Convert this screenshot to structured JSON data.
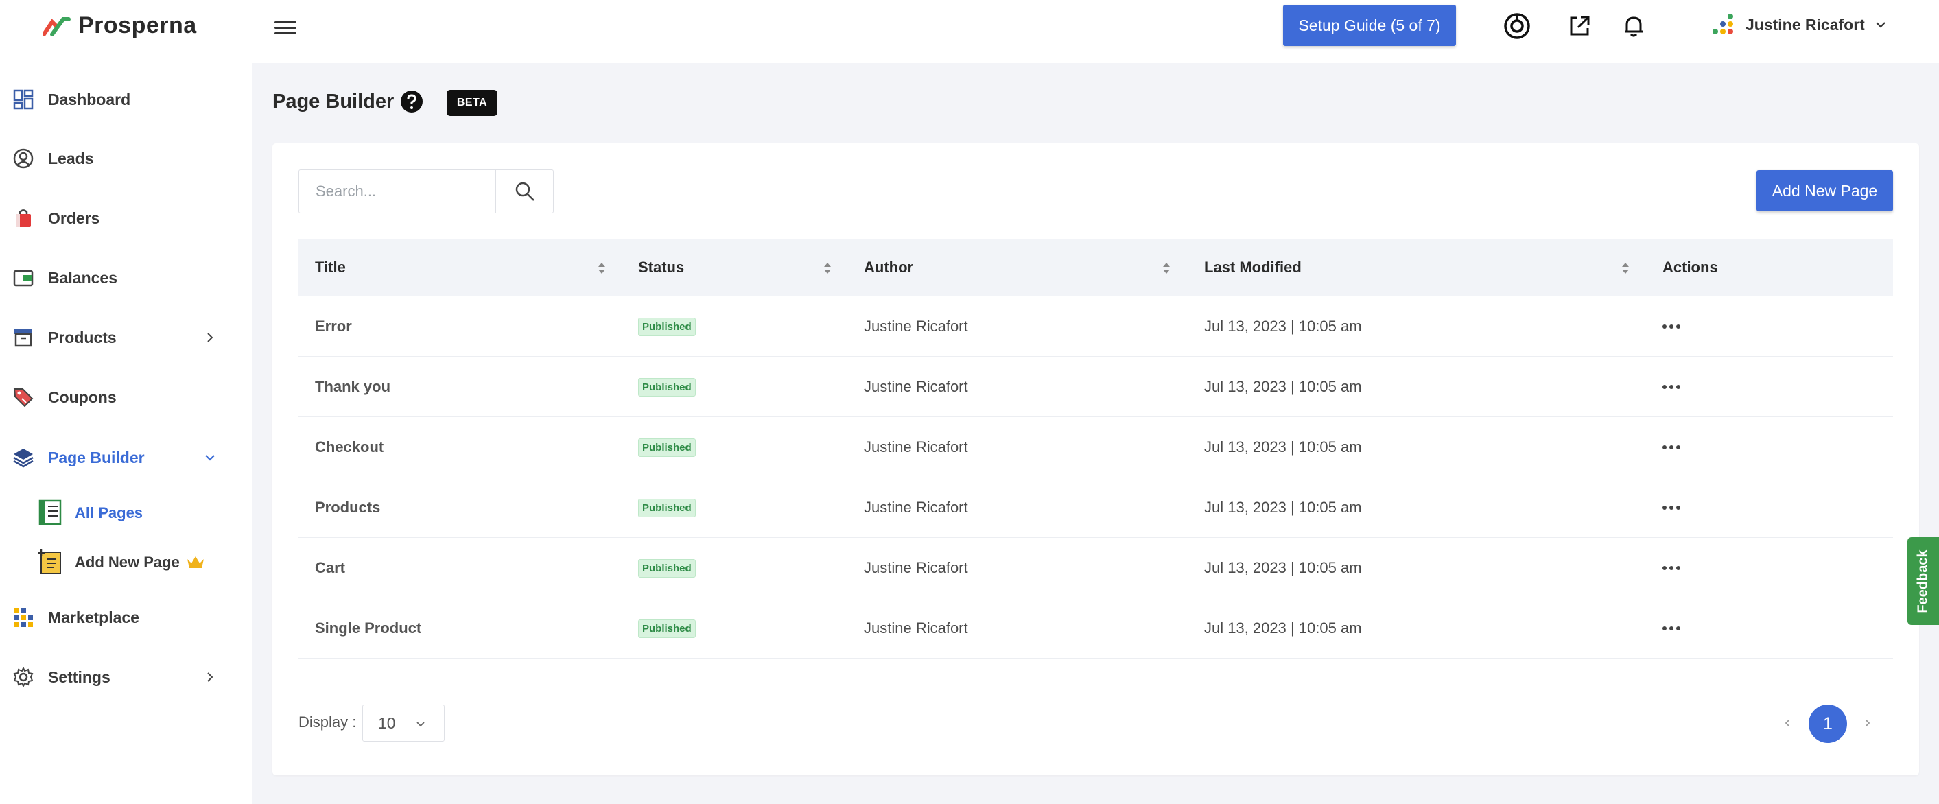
{
  "brand": {
    "name": "Prosperna"
  },
  "sidebar": {
    "items": [
      {
        "label": "Dashboard",
        "icon": "dashboard-icon"
      },
      {
        "label": "Leads",
        "icon": "user-circle-icon"
      },
      {
        "label": "Orders",
        "icon": "shopping-bag-icon"
      },
      {
        "label": "Balances",
        "icon": "wallet-icon"
      },
      {
        "label": "Products",
        "icon": "archive-box-icon"
      },
      {
        "label": "Coupons",
        "icon": "tag-icon"
      },
      {
        "label": "Page Builder",
        "icon": "layers-icon"
      },
      {
        "label": "Marketplace",
        "icon": "grid-dots-icon"
      },
      {
        "label": "Settings",
        "icon": "gear-icon"
      }
    ],
    "subitems": [
      {
        "label": "All Pages",
        "icon": "pages-list-icon"
      },
      {
        "label": "Add New Page",
        "icon": "add-page-icon",
        "badge_icon": "crown-icon"
      }
    ],
    "active_color": "#3a6bd6"
  },
  "topbar": {
    "setup_guide": "Setup Guide (5 of 7)",
    "user_name": "Justine Ricafort"
  },
  "page": {
    "title": "Page Builder",
    "beta": "BETA"
  },
  "toolbar": {
    "search_placeholder": "Search...",
    "add_new_page": "Add New Page"
  },
  "table": {
    "columns": [
      "Title",
      "Status",
      "Author",
      "Last Modified",
      "Actions"
    ],
    "rows": [
      {
        "title": "Error",
        "status": "Published",
        "author": "Justine Ricafort",
        "modified": "Jul 13, 2023 | 10:05 am"
      },
      {
        "title": "Thank you",
        "status": "Published",
        "author": "Justine Ricafort",
        "modified": "Jul 13, 2023 | 10:05 am"
      },
      {
        "title": "Checkout",
        "status": "Published",
        "author": "Justine Ricafort",
        "modified": "Jul 13, 2023 | 10:05 am"
      },
      {
        "title": "Products",
        "status": "Published",
        "author": "Justine Ricafort",
        "modified": "Jul 13, 2023 | 10:05 am"
      },
      {
        "title": "Cart",
        "status": "Published",
        "author": "Justine Ricafort",
        "modified": "Jul 13, 2023 | 10:05 am"
      },
      {
        "title": "Single Product",
        "status": "Published",
        "author": "Justine Ricafort",
        "modified": "Jul 13, 2023 | 10:05 am"
      }
    ]
  },
  "footer": {
    "display_label": "Display :",
    "display_value": "10",
    "current_page": "1"
  },
  "feedback": "Feedback",
  "colors": {
    "primary": "#3e6bd8",
    "published_bg": "#d8f3de",
    "published_text": "#2e8b46",
    "feedback": "#3c9a4a"
  }
}
